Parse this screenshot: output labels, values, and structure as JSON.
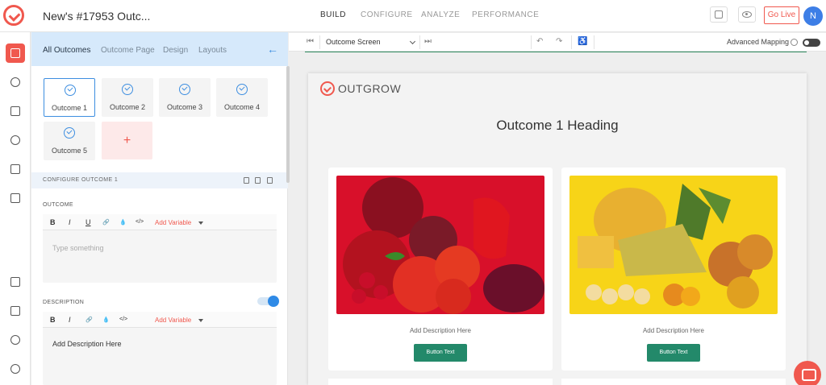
{
  "app": {
    "title": "New's #17953 Outc...",
    "nav": [
      "BUILD",
      "CONFIGURE",
      "ANALYZE",
      "PERFORMANCE"
    ],
    "active_nav": "BUILD",
    "go_live": "Go Live",
    "avatar_initial": "N",
    "brand_color": "#f0584e",
    "accent_color": "#3d8ee0"
  },
  "panel": {
    "tabs": [
      "All Outcomes",
      "Outcome Page",
      "Design",
      "Layouts"
    ],
    "outcomes": [
      "Outcome 1",
      "Outcome 2",
      "Outcome 3",
      "Outcome 4",
      "Outcome 5"
    ],
    "selected_outcome": "Outcome 1",
    "add_symbol": "+",
    "configure_title": "CONFIGURE OUTCOME 1",
    "outcome_label": "OUTCOME",
    "outcome_placeholder": "Type something",
    "description_label": "DESCRIPTION",
    "description_value": "Add Description Here",
    "toolbar": {
      "bold": "B",
      "italic": "I",
      "underline": "U",
      "link": "🔗",
      "color": "💧",
      "code": "</>",
      "add_variable": "Add Variable"
    }
  },
  "editor": {
    "screen_select": "Outcome Screen",
    "advanced_mapping": "Advanced Mapping"
  },
  "canvas": {
    "brand": "OUTGROW",
    "heading": "Outcome 1 Heading",
    "cards": [
      {
        "description": "Add Description Here",
        "button": "Button Text",
        "image": "red-fruits-vegetables"
      },
      {
        "description": "Add Description Here",
        "button": "Button Text",
        "image": "yellow-fruits"
      }
    ]
  }
}
